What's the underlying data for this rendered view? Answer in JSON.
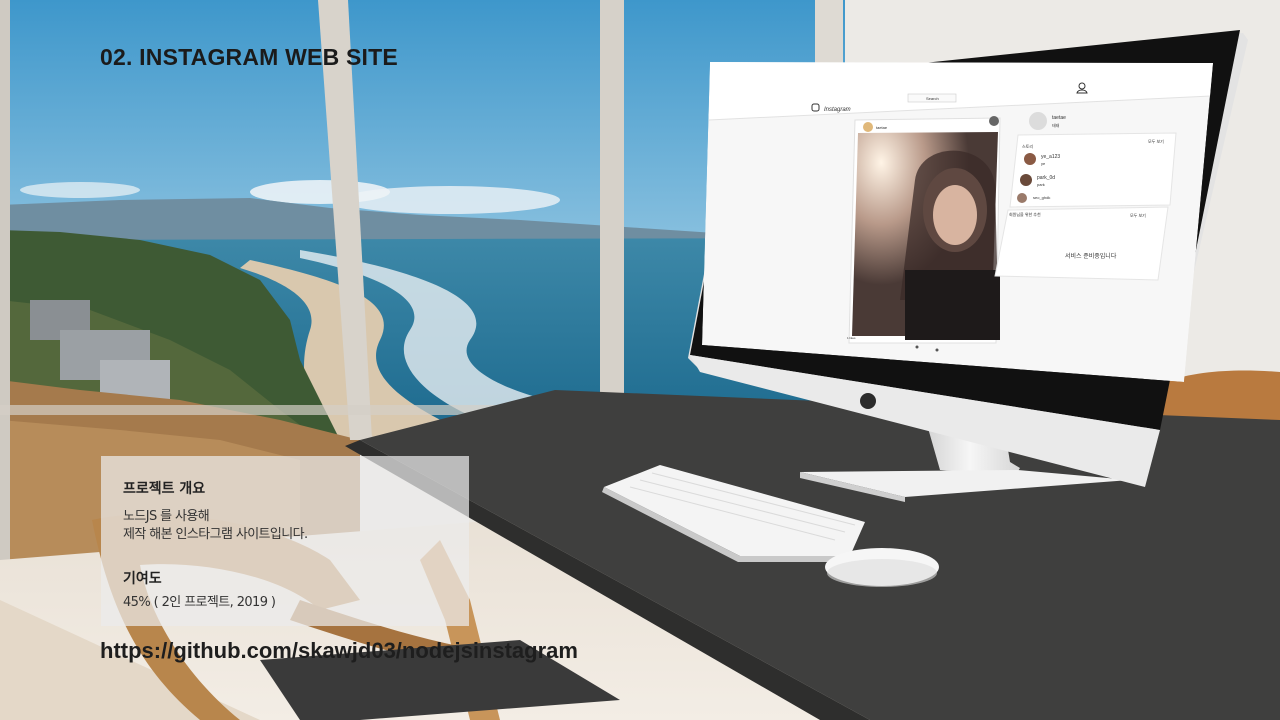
{
  "slide": {
    "title": "02. INSTAGRAM WEB SITE",
    "overview_heading": "프로젝트 개요",
    "overview_line1": "노드JS 를 사용해",
    "overview_line2": "제작 해본 인스타그램 사이트입니다.",
    "contribution_heading": "기여도",
    "contribution_value": "45% ( 2인 프로젝트, 2019 )",
    "repo_link": "https://github.com/skawjd03/nodejsinstagram"
  },
  "mockup": {
    "logo_text": "Instagram",
    "search_placeholder": "Search",
    "post_user": "taetae",
    "profile_name": "taetae",
    "profile_sub": "태태",
    "stories_label": "스토리",
    "see_all": "모두 보기",
    "stories": [
      {
        "name": "ye_a123",
        "sub": "ye"
      },
      {
        "name": "park_0d",
        "sub": "park"
      },
      {
        "name": "seo_ghdk",
        "sub": ""
      }
    ],
    "recommend_label": "회원님을 위한 추천",
    "recommend_see_all": "모두 보기",
    "service_message": "서비스 준비중입니다",
    "likes_text": "1 likes"
  },
  "colors": {
    "desk": "#3d3d3c",
    "sky": "#5aa7d2",
    "ocean": "#2c7a9c",
    "imac_body": "#e8e8e8"
  }
}
